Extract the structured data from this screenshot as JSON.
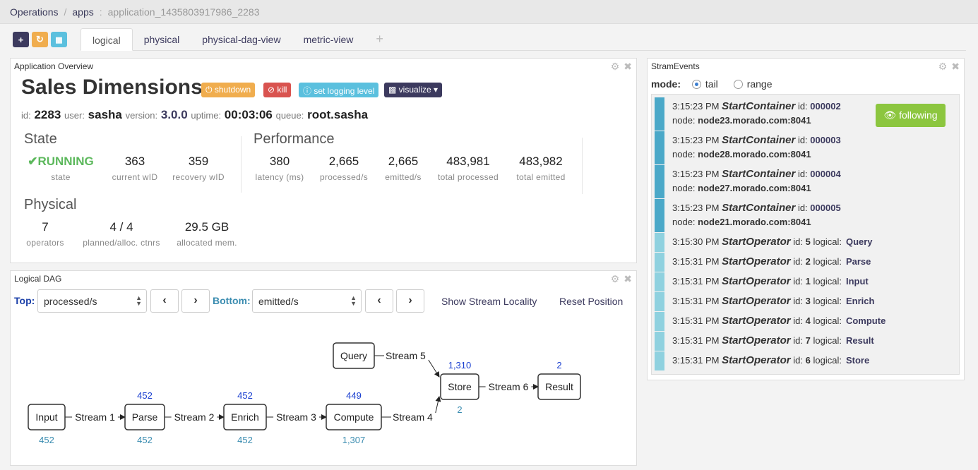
{
  "breadcrumb": {
    "operations": "Operations",
    "apps": "apps",
    "app_id": "application_1435803917986_2283"
  },
  "toolbar": {
    "add": "+",
    "undo": "↻",
    "trash": "🗑"
  },
  "tabs": {
    "logical": "logical",
    "physical": "physical",
    "physical_dag": "physical-dag-view",
    "metric": "metric-view",
    "add": "+"
  },
  "overview": {
    "title": "Application Overview",
    "app_name": "Sales Dimensions",
    "buttons": {
      "shutdown": "shutdown",
      "kill": "kill",
      "logging": "set logging level",
      "visualize": "visualize"
    },
    "meta": {
      "id_label": "id:",
      "id": "2283",
      "user_label": "user:",
      "user": "sasha",
      "version_label": "version:",
      "version": "3.0.0",
      "uptime_label": "uptime:",
      "uptime": "00:03:06",
      "queue_label": "queue:",
      "queue": "root.sasha"
    },
    "state": {
      "heading": "State",
      "status": "RUNNING",
      "status_label": "state",
      "current_wid": "363",
      "current_wid_label": "current wID",
      "recovery_wid": "359",
      "recovery_wid_label": "recovery wID"
    },
    "performance": {
      "heading": "Performance",
      "latency": "380",
      "latency_label": "latency (ms)",
      "processed": "2,665",
      "processed_label": "processed/s",
      "emitted": "2,665",
      "emitted_label": "emitted/s",
      "total_processed": "483,981",
      "total_processed_label": "total processed",
      "total_emitted": "483,982",
      "total_emitted_label": "total emitted"
    },
    "physical": {
      "heading": "Physical",
      "operators": "7",
      "operators_label": "operators",
      "containers": "4 / 4",
      "containers_label": "planned/alloc. ctnrs",
      "memory": "29.5 GB",
      "memory_label": "allocated mem."
    }
  },
  "dag": {
    "title": "Logical DAG",
    "top_label": "Top:",
    "top_value": "processed/s",
    "bottom_label": "Bottom:",
    "bottom_value": "emitted/s",
    "show_locality": "Show Stream Locality",
    "reset_position": "Reset Position",
    "nodes": [
      {
        "name": "Input",
        "top": "",
        "bottom": "452"
      },
      {
        "name": "Parse",
        "top": "452",
        "bottom": "452"
      },
      {
        "name": "Enrich",
        "top": "452",
        "bottom": "452"
      },
      {
        "name": "Compute",
        "top": "449",
        "bottom": "1,307"
      },
      {
        "name": "Query",
        "top": "",
        "bottom": ""
      },
      {
        "name": "Store",
        "top": "1,310",
        "bottom": "2"
      },
      {
        "name": "Result",
        "top": "2",
        "bottom": ""
      }
    ],
    "streams": [
      "Stream 1",
      "Stream 2",
      "Stream 3",
      "Stream 4",
      "Stream 5",
      "Stream 6"
    ]
  },
  "events": {
    "title": "StramEvents",
    "mode_label": "mode:",
    "tail": "tail",
    "range": "range",
    "following": "following",
    "container_events": [
      {
        "time": "3:15:23 PM",
        "name": "StartContainer",
        "id_label": "id:",
        "id": "000002",
        "node_label": "node:",
        "node": "node23.morado.com:8041"
      },
      {
        "time": "3:15:23 PM",
        "name": "StartContainer",
        "id_label": "id:",
        "id": "000003",
        "node_label": "node:",
        "node": "node28.morado.com:8041"
      },
      {
        "time": "3:15:23 PM",
        "name": "StartContainer",
        "id_label": "id:",
        "id": "000004",
        "node_label": "node:",
        "node": "node27.morado.com:8041"
      },
      {
        "time": "3:15:23 PM",
        "name": "StartContainer",
        "id_label": "id:",
        "id": "000005",
        "node_label": "node:",
        "node": "node21.morado.com:8041"
      }
    ],
    "operator_events": [
      {
        "time": "3:15:30 PM",
        "name": "StartOperator",
        "id_label": "id:",
        "id": "5",
        "logical_label": "logical:",
        "logical": "Query"
      },
      {
        "time": "3:15:31 PM",
        "name": "StartOperator",
        "id_label": "id:",
        "id": "2",
        "logical_label": "logical:",
        "logical": "Parse"
      },
      {
        "time": "3:15:31 PM",
        "name": "StartOperator",
        "id_label": "id:",
        "id": "1",
        "logical_label": "logical:",
        "logical": "Input"
      },
      {
        "time": "3:15:31 PM",
        "name": "StartOperator",
        "id_label": "id:",
        "id": "3",
        "logical_label": "logical:",
        "logical": "Enrich"
      },
      {
        "time": "3:15:31 PM",
        "name": "StartOperator",
        "id_label": "id:",
        "id": "4",
        "logical_label": "logical:",
        "logical": "Compute"
      },
      {
        "time": "3:15:31 PM",
        "name": "StartOperator",
        "id_label": "id:",
        "id": "7",
        "logical_label": "logical:",
        "logical": "Result"
      },
      {
        "time": "3:15:31 PM",
        "name": "StartOperator",
        "id_label": "id:",
        "id": "6",
        "logical_label": "logical:",
        "logical": "Store"
      }
    ]
  },
  "colors": {
    "primary": "#3c3a5e",
    "warning": "#f0ad4e",
    "danger": "#d9534f",
    "info": "#5bc0de",
    "success": "#5cb85c",
    "following": "#8cc63f",
    "container_bar": "#4aa8c8",
    "operator_bar": "#8fd1df"
  }
}
